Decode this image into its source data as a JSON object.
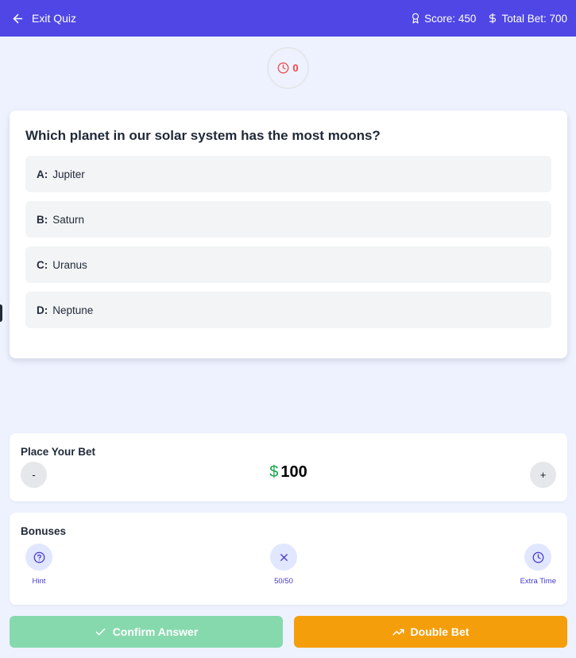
{
  "header": {
    "exit_label": "Exit Quiz",
    "score_label": "Score: 450",
    "total_bet_label": "Total Bet: 700"
  },
  "timer": {
    "value": "0"
  },
  "question": {
    "text": "Which planet in our solar system has the most moons?",
    "options": [
      {
        "letter": "A:",
        "text": "Jupiter"
      },
      {
        "letter": "B:",
        "text": "Saturn"
      },
      {
        "letter": "C:",
        "text": "Uranus"
      },
      {
        "letter": "D:",
        "text": "Neptune"
      }
    ]
  },
  "bet": {
    "title": "Place Your Bet",
    "minus_label": "-",
    "plus_label": "+",
    "currency": "$",
    "amount": "100"
  },
  "bonuses": {
    "title": "Bonuses",
    "items": [
      {
        "label": "Hint",
        "icon": "help-circle-icon"
      },
      {
        "label": "50/50",
        "icon": "close-icon"
      },
      {
        "label": "Extra Time",
        "icon": "clock-icon"
      }
    ]
  },
  "actions": {
    "confirm_label": "Confirm Answer",
    "double_label": "Double Bet"
  },
  "colors": {
    "header": "#4f46e5",
    "background": "#eef2ff",
    "timer_text": "#ef4444",
    "currency": "#16a34a",
    "confirm": "#86d9ac",
    "double": "#f59e0b",
    "bonus_accent": "#4338ca"
  }
}
